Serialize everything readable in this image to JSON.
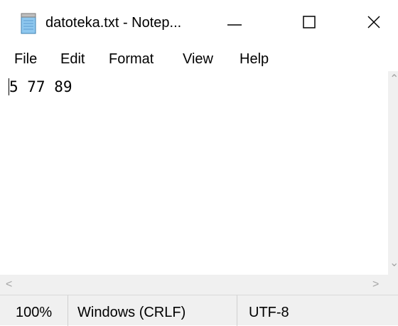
{
  "window": {
    "title": "datoteka.txt - Notep...",
    "icon": "notepad-icon",
    "controls": {
      "minimize": "minimize-icon",
      "maximize": "maximize-icon",
      "close": "close-icon"
    }
  },
  "menu": {
    "items": [
      {
        "label": "File"
      },
      {
        "label": "Edit"
      },
      {
        "label": "Format"
      },
      {
        "label": "View"
      },
      {
        "label": "Help"
      }
    ]
  },
  "editor": {
    "content": "5 77 89"
  },
  "status": {
    "zoom": "100%",
    "line_ending": "Windows (CRLF)",
    "encoding": "UTF-8"
  },
  "colors": {
    "chrome_gray": "#f0f0f0",
    "arrow_gray": "#a6a6a6"
  }
}
